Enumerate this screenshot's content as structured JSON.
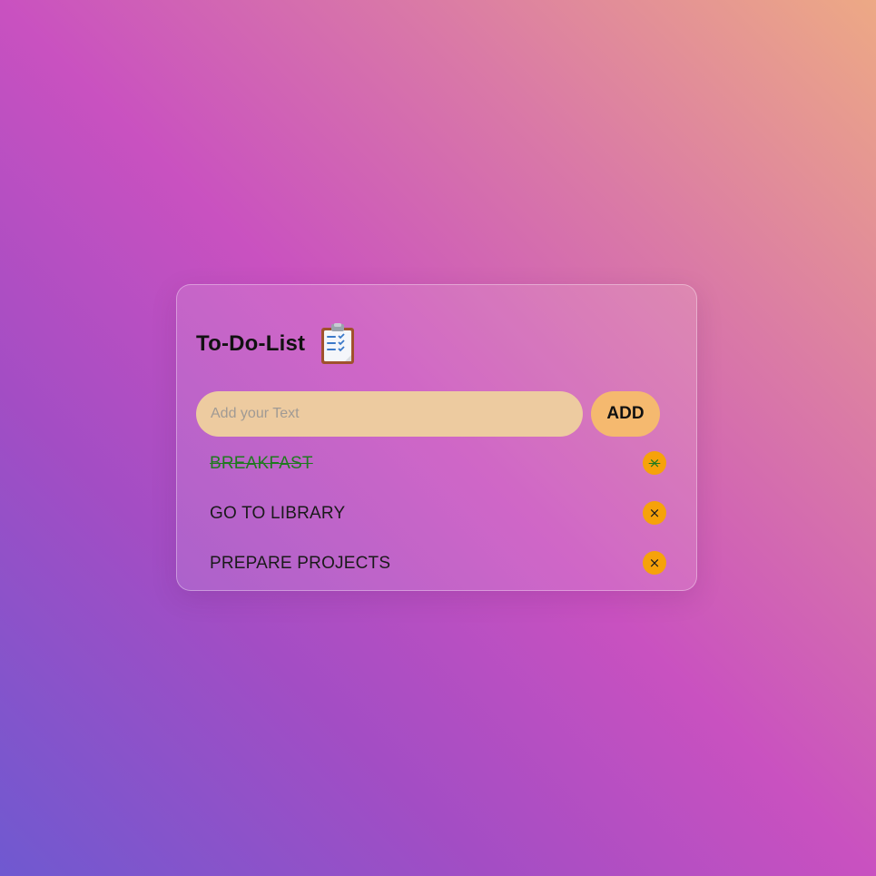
{
  "header": {
    "title": "To-Do-List",
    "icon": "clipboard-icon"
  },
  "input": {
    "value": "",
    "placeholder": "Add your Text"
  },
  "add_button": {
    "label": "ADD"
  },
  "todos": [
    {
      "text": "BREAKFAST",
      "done": true,
      "delete_label": "×"
    },
    {
      "text": "GO TO LIBRARY",
      "done": false,
      "delete_label": "×"
    },
    {
      "text": "PREPARE PROJECTS",
      "done": false,
      "delete_label": "×"
    }
  ],
  "colors": {
    "input_bg": "#edcba0",
    "add_button_bg": "#f5b96f",
    "delete_button_bg": "#f6a20a",
    "done_text": "#1f7a1f"
  }
}
